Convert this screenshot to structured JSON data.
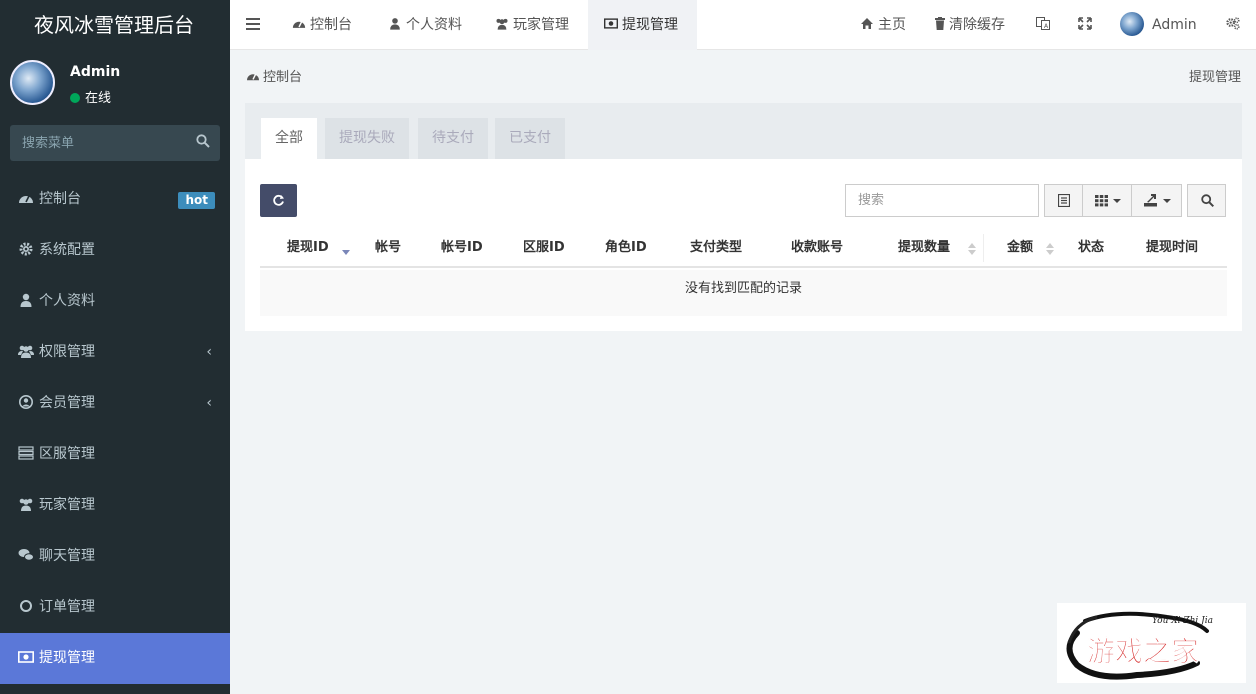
{
  "app": {
    "title": "夜风冰雪管理后台"
  },
  "user": {
    "name": "Admin",
    "status": "在线"
  },
  "sidebar": {
    "search_placeholder": "搜索菜单",
    "items": [
      {
        "label": "控制台",
        "icon": "dashboard-icon",
        "badge": "hot",
        "active": false
      },
      {
        "label": "系统配置",
        "icon": "gear-icon",
        "active": false
      },
      {
        "label": "个人资料",
        "icon": "user-icon",
        "active": false
      },
      {
        "label": "权限管理",
        "icon": "group-icon",
        "chevron": "‹",
        "active": false
      },
      {
        "label": "会员管理",
        "icon": "user-circle-icon",
        "chevron": "‹",
        "active": false
      },
      {
        "label": "区服管理",
        "icon": "server-list-icon",
        "active": false
      },
      {
        "label": "玩家管理",
        "icon": "users-icon",
        "active": false
      },
      {
        "label": "聊天管理",
        "icon": "chat-icon",
        "active": false
      },
      {
        "label": "订单管理",
        "icon": "circle-icon",
        "active": false
      },
      {
        "label": "提现管理",
        "icon": "money-icon",
        "active": true
      }
    ]
  },
  "topnav": {
    "tabs": [
      {
        "label": "控制台",
        "icon": "dashboard-icon"
      },
      {
        "label": "个人资料",
        "icon": "user-icon"
      },
      {
        "label": "玩家管理",
        "icon": "users-icon"
      },
      {
        "label": "提现管理",
        "icon": "money-icon",
        "active": true
      }
    ],
    "home_label": "主页",
    "clear_cache_label": "清除缓存",
    "user_label": "Admin"
  },
  "breadcrumb": {
    "left": "控制台",
    "right": "提现管理"
  },
  "panel": {
    "tabs": [
      "全部",
      "提现失败",
      "待支付",
      "已支付"
    ],
    "search_placeholder": "搜索"
  },
  "table": {
    "columns": [
      "提现ID",
      "帐号",
      "帐号ID",
      "区服ID",
      "角色ID",
      "支付类型",
      "收款账号",
      "提现数量",
      "金额",
      "状态",
      "提现时间"
    ],
    "empty_text": "没有找到匹配的记录"
  },
  "watermark": {
    "text": "游戏之家",
    "subtext": "You Xi Zhi Jia"
  },
  "colors": {
    "sidebar_bg": "#222d32",
    "active_menu": "#5b78d8",
    "hot_badge": "#3c8dbc",
    "online_dot": "#00a65a",
    "refresh_btn": "#444c69"
  }
}
